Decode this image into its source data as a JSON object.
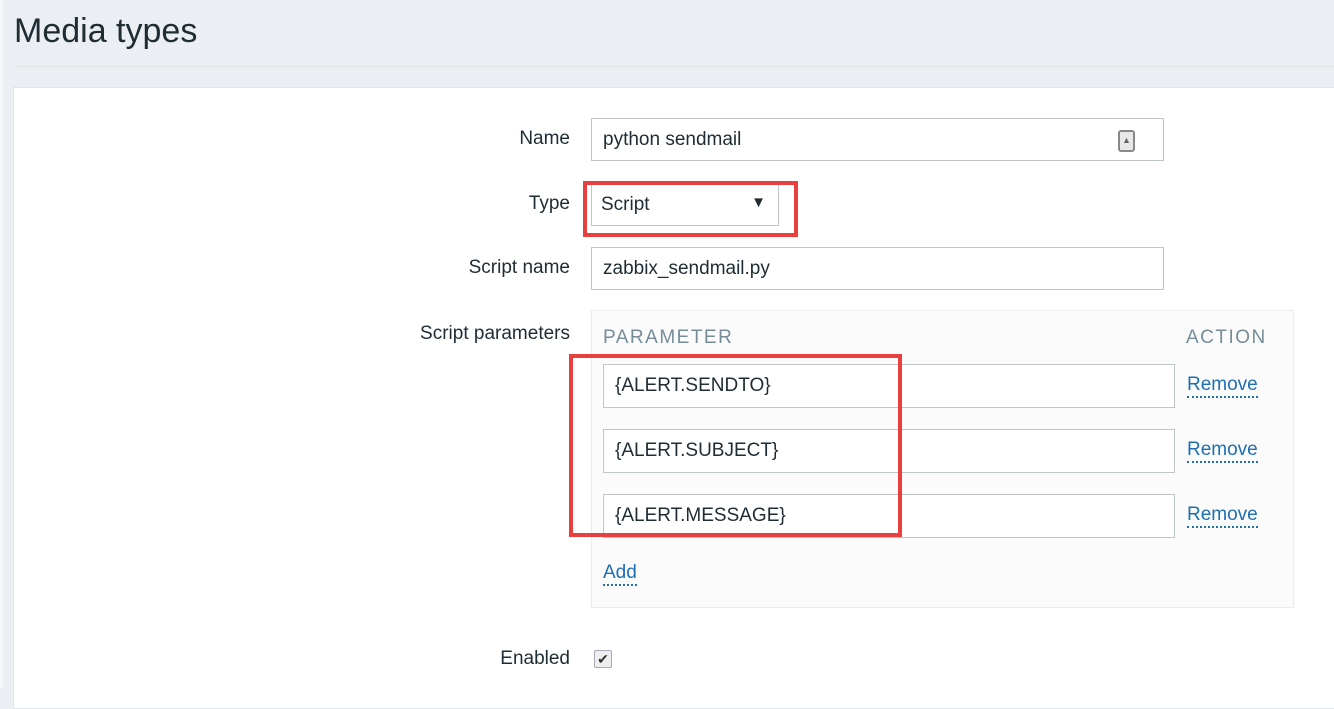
{
  "page": {
    "title": "Media types"
  },
  "form": {
    "name": {
      "label": "Name",
      "value": "python sendmail"
    },
    "type": {
      "label": "Type",
      "value": "Script"
    },
    "script_name": {
      "label": "Script name",
      "value": "zabbix_sendmail.py"
    },
    "script_parameters": {
      "label": "Script parameters",
      "col_parameter": "PARAMETER",
      "col_action": "ACTION",
      "rows": [
        {
          "value": "{ALERT.SENDTO}",
          "action": "Remove"
        },
        {
          "value": "{ALERT.SUBJECT}",
          "action": "Remove"
        },
        {
          "value": "{ALERT.MESSAGE}",
          "action": "Remove"
        }
      ],
      "add_label": "Add"
    },
    "enabled": {
      "label": "Enabled",
      "checked": true
    }
  },
  "colors": {
    "highlight": "#e8403e",
    "link": "#1f6fb0",
    "background": "#ebeef2"
  }
}
